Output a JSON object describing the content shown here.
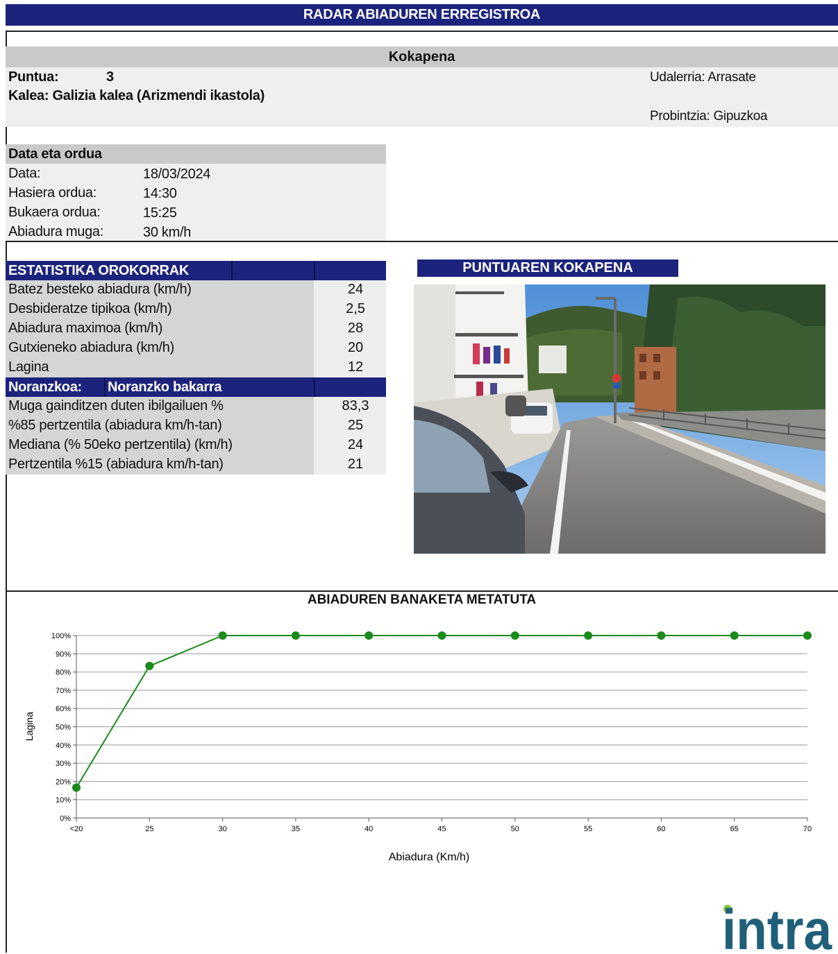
{
  "header": {
    "title": "RADAR ABIADUREN ERREGISTROA"
  },
  "location": {
    "section_title": "Kokapena",
    "point_label": "Puntua:",
    "point_value": "3",
    "street": "Kalea: Galizia kalea (Arizmendi ikastola)",
    "municipality": "Udalerria: Arrasate",
    "province": "Probintzia: Gipuzkoa"
  },
  "datetime": {
    "section_title": "Data eta ordua",
    "rows": [
      {
        "label": "Data:",
        "value": "18/03/2024"
      },
      {
        "label": "Hasiera ordua:",
        "value": "14:30"
      },
      {
        "label": "Bukaera ordua:",
        "value": "15:25"
      },
      {
        "label": "Abiadura muga:",
        "value": "30 km/h"
      }
    ]
  },
  "stats": {
    "section_title": "ESTATISTIKA OROKORRAK",
    "rows": [
      {
        "label": "Batez besteko abiadura (km/h)",
        "value": "24"
      },
      {
        "label": "Desbideratze tipikoa (km/h)",
        "value": "2,5"
      },
      {
        "label": "Abiadura maximoa (km/h)",
        "value": "28"
      },
      {
        "label": "Gutxieneko abiadura (km/h)",
        "value": "20"
      },
      {
        "label": "Lagina",
        "value": "12"
      }
    ],
    "direction_label": "Noranzkoa:",
    "direction_value": "Noranzko bakarra",
    "rows2": [
      {
        "label": "Muga gainditzen duten ibilgailuen %",
        "value": "83,3"
      },
      {
        "label": "%85 pertzentila (abiadura km/h-tan)",
        "value": "25"
      },
      {
        "label": "Mediana (% 50eko pertzentila) (km/h)",
        "value": "24"
      },
      {
        "label": "Pertzentila %15 (abiadura km/h-tan)",
        "value": "21"
      }
    ]
  },
  "photo_section": {
    "title": "PUNTUAREN KOKAPENA"
  },
  "chart_data": {
    "type": "line",
    "title": "ABIADUREN BANAKETA METATUTA",
    "xlabel": "Abiadura (Km/h)",
    "ylabel": "Lagina",
    "categories": [
      "<20",
      "25",
      "30",
      "35",
      "40",
      "45",
      "50",
      "55",
      "60",
      "65",
      "70"
    ],
    "values": [
      16.7,
      83.3,
      100,
      100,
      100,
      100,
      100,
      100,
      100,
      100,
      100
    ],
    "ylim": [
      0,
      100
    ],
    "yticks": [
      "0%",
      "10%",
      "20%",
      "30%",
      "40%",
      "50%",
      "60%",
      "70%",
      "80%",
      "90%",
      "100%"
    ],
    "grid": true,
    "color": "#1a8a1a"
  },
  "logo": {
    "text": "intra",
    "color": "#1f5f7a",
    "dot_color": "#8cc63f"
  }
}
